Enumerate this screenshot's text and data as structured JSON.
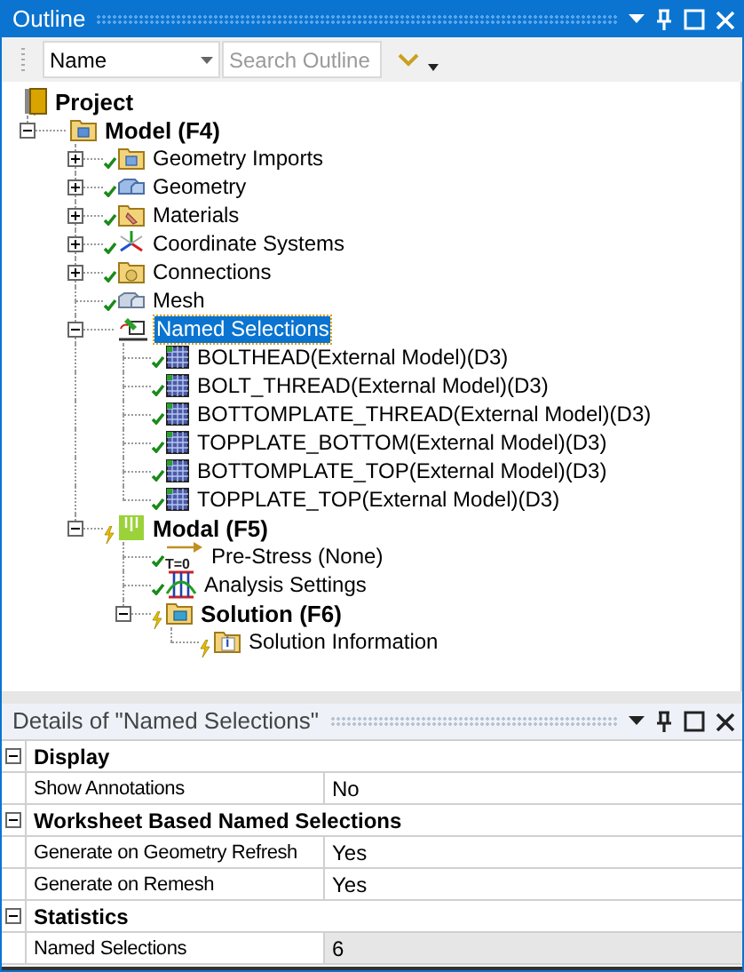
{
  "outline_panel": {
    "title": "Outline",
    "active": true
  },
  "toolbar": {
    "filter_select": {
      "value": "Name"
    },
    "search": {
      "placeholder": "Search Outline"
    }
  },
  "tree": [
    {
      "label": "Project",
      "kind": "project",
      "bold": true,
      "selected": false,
      "children": [
        {
          "label": "Model (F4)",
          "kind": "model",
          "bold": true,
          "expanded": true,
          "selected": false,
          "children": [
            {
              "label": "Geometry Imports",
              "kind": "geometry-imports",
              "up_to_date": true,
              "expanded": false,
              "selected": false
            },
            {
              "label": "Geometry",
              "kind": "geometry",
              "up_to_date": true,
              "expanded": false,
              "selected": false
            },
            {
              "label": "Materials",
              "kind": "materials",
              "up_to_date": true,
              "expanded": false,
              "selected": false
            },
            {
              "label": "Coordinate Systems",
              "kind": "coordinate-systems",
              "up_to_date": true,
              "expanded": false,
              "selected": false
            },
            {
              "label": "Connections",
              "kind": "connections",
              "up_to_date": true,
              "expanded": false,
              "selected": false
            },
            {
              "label": "Mesh",
              "kind": "mesh",
              "up_to_date": true,
              "selected": false
            },
            {
              "label": "Named Selections",
              "kind": "named-selections",
              "expanded": true,
              "selected": true,
              "children": [
                {
                  "label": "BOLTHEAD(External Model)(D3)",
                  "kind": "named-selection",
                  "up_to_date": true,
                  "selected": false
                },
                {
                  "label": "BOLT_THREAD(External Model)(D3)",
                  "kind": "named-selection",
                  "up_to_date": true,
                  "selected": false
                },
                {
                  "label": "BOTTOMPLATE_THREAD(External Model)(D3)",
                  "kind": "named-selection",
                  "up_to_date": true,
                  "selected": false
                },
                {
                  "label": "TOPPLATE_BOTTOM(External Model)(D3)",
                  "kind": "named-selection",
                  "up_to_date": true,
                  "selected": false
                },
                {
                  "label": "BOTTOMPLATE_TOP(External Model)(D3)",
                  "kind": "named-selection",
                  "up_to_date": true,
                  "selected": false
                },
                {
                  "label": "TOPPLATE_TOP(External Model)(D3)",
                  "kind": "named-selection",
                  "up_to_date": true,
                  "selected": false
                }
              ]
            },
            {
              "label": "Modal (F5)",
              "kind": "modal",
              "up_to_date": false,
              "bold": true,
              "expanded": true,
              "selected": false,
              "children": [
                {
                  "label": "Pre-Stress (None)",
                  "kind": "pre-stress",
                  "icon_text": "T=0",
                  "up_to_date": true,
                  "selected": false
                },
                {
                  "label": "Analysis Settings",
                  "kind": "analysis-settings",
                  "up_to_date": true,
                  "selected": false
                },
                {
                  "label": "Solution (F6)",
                  "kind": "solution",
                  "up_to_date": false,
                  "bold": true,
                  "expanded": true,
                  "selected": false,
                  "children": [
                    {
                      "label": "Solution Information",
                      "kind": "solution-information",
                      "icon_text": "i",
                      "up_to_date": false,
                      "selected": false
                    }
                  ]
                }
              ]
            }
          ]
        }
      ]
    }
  ],
  "details_panel": {
    "title": "Details of \"Named Selections\"",
    "active": false,
    "sections": [
      {
        "title": "Display",
        "expanded": true,
        "rows": [
          {
            "label": "Show Annotations",
            "value": "No",
            "readonly": false
          }
        ]
      },
      {
        "title": "Worksheet Based Named Selections",
        "expanded": true,
        "rows": [
          {
            "label": "Generate on Geometry Refresh",
            "value": "Yes",
            "readonly": false
          },
          {
            "label": "Generate on Remesh",
            "value": "Yes",
            "readonly": false
          }
        ]
      },
      {
        "title": "Statistics",
        "expanded": true,
        "rows": [
          {
            "label": "Named Selections",
            "value": "6",
            "readonly": true
          }
        ]
      }
    ]
  }
}
